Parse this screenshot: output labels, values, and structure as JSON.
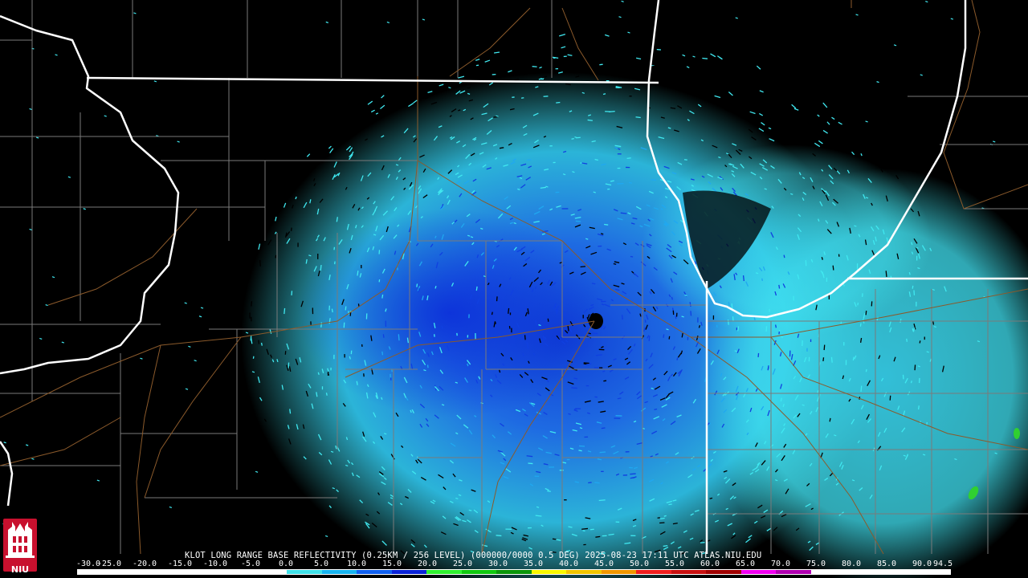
{
  "caption": "KLOT LONG RANGE BASE REFLECTIVITY (0.25KM / 256 LEVEL) (000000/0000 0.5 DEG) 2025-08-23 17:11 UTC  ATLAS.NIU.EDU",
  "logo": {
    "text": "NIU",
    "icon": "niu-tower-logo-icon",
    "color": "#c8102e"
  },
  "scale": {
    "labels": [
      "-30.0",
      "-25.0",
      "-20.0",
      "-15.0",
      "-10.0",
      "-5.0",
      "0.0",
      "5.0",
      "10.0",
      "15.0",
      "20.0",
      "25.0",
      "30.0",
      "35.0",
      "40.0",
      "45.0",
      "50.0",
      "55.0",
      "60.0",
      "65.0",
      "70.0",
      "75.0",
      "80.0",
      "85.0",
      "90.0",
      "94.5"
    ],
    "colors": [
      "#ffffff",
      "#ffffff",
      "#ffffff",
      "#ffffff",
      "#ffffff",
      "#ffffff",
      "#40e0e8",
      "#18b4f0",
      "#1060f0",
      "#0a22d8",
      "#30f030",
      "#10c810",
      "#0a960a",
      "#f8f800",
      "#f0c400",
      "#f09600",
      "#f01e1e",
      "#c81010",
      "#a00000",
      "#f000f0",
      "#b000b0",
      "#ffffff",
      "#ffffff",
      "#ffffff",
      "#ffffff"
    ]
  },
  "colors": {
    "echo_light": "#40e8f0",
    "echo_mid": "#20a8f0",
    "echo_dark": "#1040e0",
    "state_border": "#ffffff",
    "county_border": "#7a7a7a",
    "road": "#8b5a2b"
  }
}
